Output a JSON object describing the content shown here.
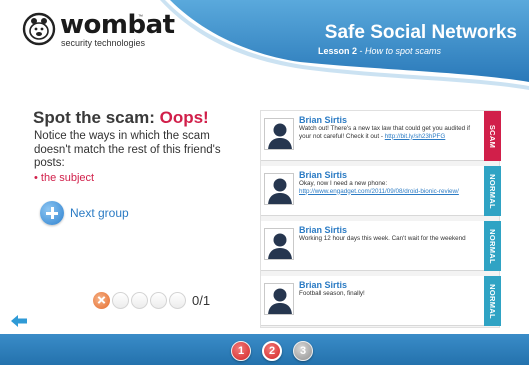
{
  "header": {
    "brand": "wombat",
    "brand_tm": "™",
    "brand_sub": "security technologies",
    "course_title": "Safe Social Networks",
    "lesson_number": "Lesson 2",
    "lesson_separator": " - ",
    "lesson_title": "How to spot scams"
  },
  "activity": {
    "heading": "Spot the scam:",
    "result": "Oops!",
    "instruction": "Notice the ways in which the scam doesn't match the rest of this friend's posts:",
    "hint": "• the subject",
    "next_label": "Next group",
    "score": "0/1",
    "progress_states": [
      "wrong",
      "empty",
      "empty",
      "empty",
      "empty"
    ]
  },
  "feed": {
    "posts": [
      {
        "author": "Brian Sirtis",
        "text": "Watch out! There's a new tax law that could get you audited if your not careful! Check it out - ",
        "link": "http://bit.ly/sh23hPFG",
        "tag": "SCAM"
      },
      {
        "author": "Brian Sirtis",
        "text": "Okay, now I need a new phone:",
        "link": "http://www.engadget.com/2011/09/08/droid-bionic-review/",
        "tag": "NORMAL"
      },
      {
        "author": "Brian Sirtis",
        "text": "Working 12 hour days this week. Can't wait for the weekend",
        "link": "",
        "tag": "NORMAL"
      },
      {
        "author": "Brian Sirtis",
        "text": "Football season, finally!",
        "link": "",
        "tag": "NORMAL"
      }
    ]
  },
  "footer": {
    "lessons": [
      {
        "label": "1",
        "state": "done"
      },
      {
        "label": "2",
        "state": "current"
      },
      {
        "label": "3",
        "state": "locked"
      }
    ]
  },
  "colors": {
    "brand_blue": "#2b7bc4",
    "scam_red": "#d11f4a",
    "normal_teal": "#2fa3c4",
    "footer_blue": "#2472ad"
  },
  "icons": {
    "logo": "wombat-logo-icon",
    "next": "plus-circle-icon",
    "wrong": "x-icon",
    "back": "back-arrow-icon",
    "avatar": "person-silhouette-icon"
  }
}
